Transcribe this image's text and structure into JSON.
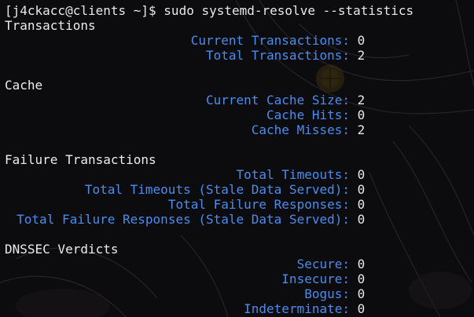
{
  "terminal": {
    "prompt": "[j4ckacc@clients ~]$",
    "command": "sudo systemd-resolve --statistics",
    "sections": [
      {
        "title": "Transactions",
        "rows": [
          {
            "label": "Current Transactions:",
            "value": "0"
          },
          {
            "label": "Total Transactions:",
            "value": "2"
          }
        ]
      },
      {
        "title": "Cache",
        "rows": [
          {
            "label": "Current Cache Size:",
            "value": "2"
          },
          {
            "label": "Cache Hits:",
            "value": "0"
          },
          {
            "label": "Cache Misses:",
            "value": "2"
          }
        ]
      },
      {
        "title": "Failure Transactions",
        "rows": [
          {
            "label": "Total Timeouts:",
            "value": "0"
          },
          {
            "label": "Total Timeouts (Stale Data Served):",
            "value": "0"
          },
          {
            "label": "Total Failure Responses:",
            "value": "0"
          },
          {
            "label": "Total Failure Responses (Stale Data Served):",
            "value": "0"
          }
        ]
      },
      {
        "title": "DNSSEC Verdicts",
        "rows": [
          {
            "label": "Secure:",
            "value": "0"
          },
          {
            "label": "Insecure:",
            "value": "0"
          },
          {
            "label": "Bogus:",
            "value": "0"
          },
          {
            "label": "Indeterminate:",
            "value": "0"
          }
        ]
      }
    ]
  },
  "colors": {
    "background": "#0c0b0d",
    "label": "#4a8df0",
    "text": "#e8e8e8"
  }
}
